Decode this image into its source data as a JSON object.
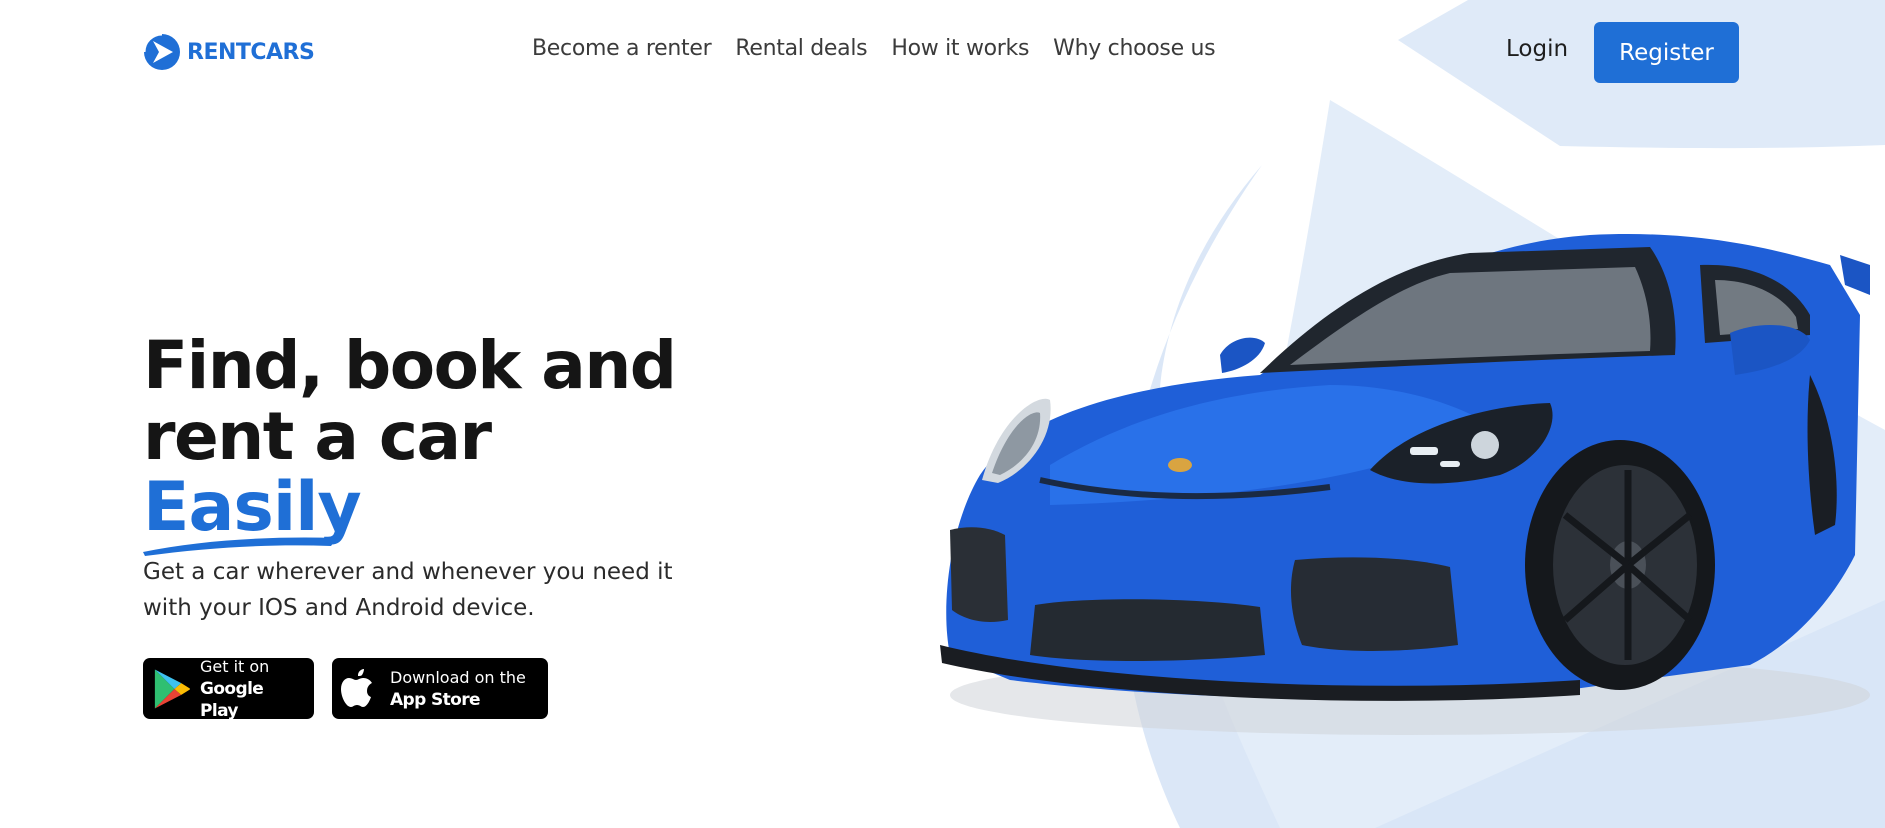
{
  "brand": {
    "name": "RENTCARS",
    "color": "#1f6fd6",
    "logo_icon": "play-arrow-logo-icon"
  },
  "nav": {
    "items": [
      {
        "label": "Become a renter"
      },
      {
        "label": "Rental deals"
      },
      {
        "label": "How it works"
      },
      {
        "label": "Why choose us"
      }
    ],
    "login_label": "Login",
    "register_label": "Register"
  },
  "hero": {
    "title_line1": "Find, book and",
    "title_line2": "rent a car",
    "title_accent": "Easily",
    "subtitle_line1": "Get a car wherever and whenever you need it",
    "subtitle_line2": "with your IOS and Android device."
  },
  "stores": {
    "google_play": {
      "small": "Get it on",
      "big": "Google Play",
      "icon": "google-play-icon"
    },
    "app_store": {
      "small": "Download on the",
      "big": "App Store",
      "icon": "apple-icon"
    }
  },
  "colors": {
    "accent": "#1f6fd6",
    "background_shape": "#dde9f8",
    "car_body": "#1f5fd8"
  }
}
